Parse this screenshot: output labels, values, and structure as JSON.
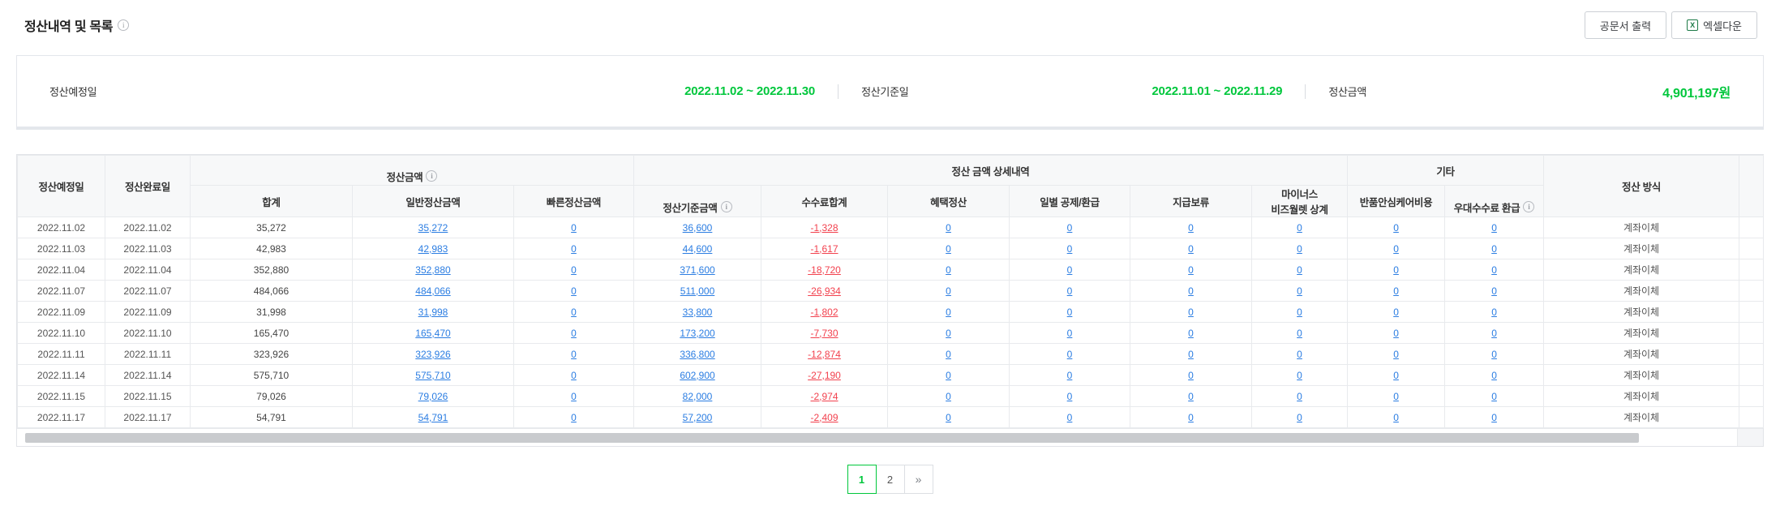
{
  "header": {
    "title": "정산내역 및 목록",
    "doc_button_label": "공문서 출력",
    "excel_button_label": "엑셀다운"
  },
  "summary": {
    "items": [
      {
        "label": "정산예정일",
        "value": "2022.11.02 ~ 2022.11.30"
      },
      {
        "label": "정산기준일",
        "value": "2022.11.01 ~ 2022.11.29"
      },
      {
        "label": "정산금액",
        "value": "4,901,197원"
      }
    ]
  },
  "table": {
    "header": {
      "date_expected": "정산예정일",
      "date_completed": "정산완료일",
      "group_amount": "정산금액",
      "group_detail": "정산 금액 상세내역",
      "group_etc": "기타",
      "sum": "합계",
      "normal": "일반정산금액",
      "quick": "빠른정산금액",
      "base": "정산기준금액",
      "fee": "수수료합계",
      "benefit": "혜택정산",
      "daily": "일별 공제/환급",
      "hold": "지급보류",
      "minus": "마이너스\n비즈월렛 상계",
      "care": "반품안심케어비용",
      "refund": "우대수수료 환급",
      "method": "정산 방식"
    },
    "rows": [
      [
        "2022.11.02",
        "2022.11.02",
        "35,272",
        "35,272",
        "0",
        "36,600",
        "-1,328",
        "0",
        "0",
        "0",
        "0",
        "0",
        "0",
        "계좌이체"
      ],
      [
        "2022.11.03",
        "2022.11.03",
        "42,983",
        "42,983",
        "0",
        "44,600",
        "-1,617",
        "0",
        "0",
        "0",
        "0",
        "0",
        "0",
        "계좌이체"
      ],
      [
        "2022.11.04",
        "2022.11.04",
        "352,880",
        "352,880",
        "0",
        "371,600",
        "-18,720",
        "0",
        "0",
        "0",
        "0",
        "0",
        "0",
        "계좌이체"
      ],
      [
        "2022.11.07",
        "2022.11.07",
        "484,066",
        "484,066",
        "0",
        "511,000",
        "-26,934",
        "0",
        "0",
        "0",
        "0",
        "0",
        "0",
        "계좌이체"
      ],
      [
        "2022.11.09",
        "2022.11.09",
        "31,998",
        "31,998",
        "0",
        "33,800",
        "-1,802",
        "0",
        "0",
        "0",
        "0",
        "0",
        "0",
        "계좌이체"
      ],
      [
        "2022.11.10",
        "2022.11.10",
        "165,470",
        "165,470",
        "0",
        "173,200",
        "-7,730",
        "0",
        "0",
        "0",
        "0",
        "0",
        "0",
        "계좌이체"
      ],
      [
        "2022.11.11",
        "2022.11.11",
        "323,926",
        "323,926",
        "0",
        "336,800",
        "-12,874",
        "0",
        "0",
        "0",
        "0",
        "0",
        "0",
        "계좌이체"
      ],
      [
        "2022.11.14",
        "2022.11.14",
        "575,710",
        "575,710",
        "0",
        "602,900",
        "-27,190",
        "0",
        "0",
        "0",
        "0",
        "0",
        "0",
        "계좌이체"
      ],
      [
        "2022.11.15",
        "2022.11.15",
        "79,026",
        "79,026",
        "0",
        "82,000",
        "-2,974",
        "0",
        "0",
        "0",
        "0",
        "0",
        "0",
        "계좌이체"
      ],
      [
        "2022.11.17",
        "2022.11.17",
        "54,791",
        "54,791",
        "0",
        "57,200",
        "-2,409",
        "0",
        "0",
        "0",
        "0",
        "0",
        "0",
        "계좌이체"
      ]
    ]
  },
  "pagination": {
    "pages": [
      {
        "label": "1",
        "active": true
      },
      {
        "label": "2",
        "active": false
      }
    ],
    "next_label": "»",
    "active_page": "1"
  },
  "colors": {
    "accent_green": "#00c73c",
    "link_blue": "#2b7de2",
    "negative_red": "#f2414e",
    "header_bg": "#f7f8f9",
    "border": "#e8eaed"
  }
}
